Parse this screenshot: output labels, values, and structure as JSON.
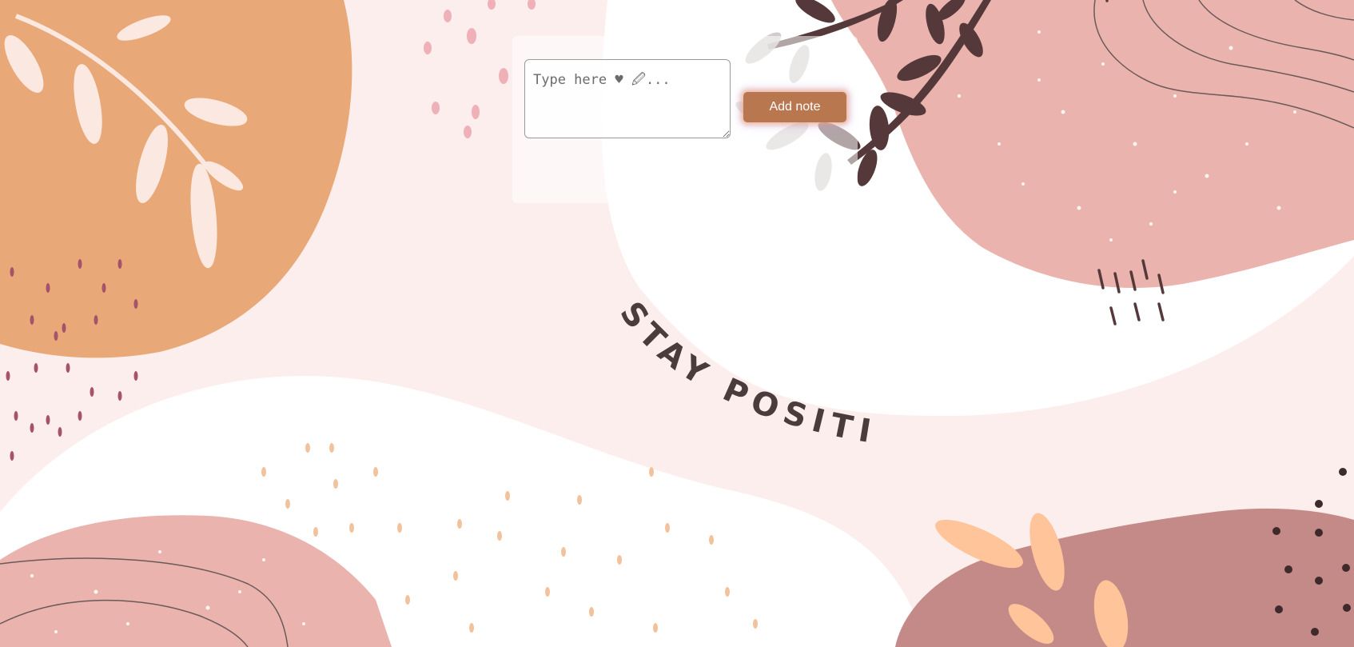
{
  "note_form": {
    "placeholder": "Type here ♥ 🖉...",
    "add_button_label": "Add note"
  },
  "background": {
    "slogan": "STAY POSITIVE"
  },
  "colors": {
    "page_background": "#fdeeee",
    "button": "#b8774f",
    "orange_blob": "#e9a877",
    "pink_blob": "#eab3ad",
    "mauve_blob": "#c48a87",
    "leaf_dark": "#55393a",
    "peach_leaf": "#ffc49a"
  }
}
